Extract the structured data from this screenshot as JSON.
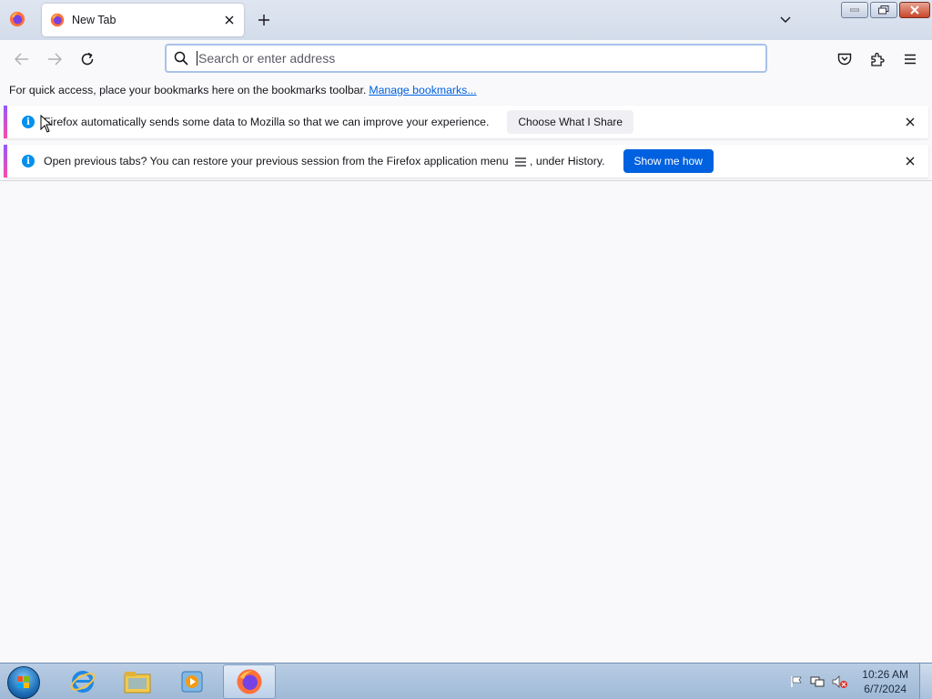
{
  "browser": {
    "tab": {
      "title": "New Tab"
    },
    "urlbar": {
      "placeholder": "Search or enter address",
      "value": ""
    }
  },
  "bookmarks_bar": {
    "text": "For quick access, place your bookmarks here on the bookmarks toolbar.",
    "link": "Manage bookmarks..."
  },
  "notifications": [
    {
      "message": "Firefox automatically sends some data to Mozilla so that we can improve your experience.",
      "button": "Choose What I Share"
    },
    {
      "message_before": "Open previous tabs? You can restore your previous session from the Firefox application menu",
      "message_after": ", under History.",
      "button": "Show me how"
    }
  ],
  "taskbar": {
    "clock_time": "10:26 AM",
    "clock_date": "6/7/2024"
  },
  "icons": [
    "firefox-icon",
    "close-icon",
    "plus-icon",
    "chevron-down-icon",
    "back-icon",
    "forward-icon",
    "reload-icon",
    "search-icon",
    "pocket-icon",
    "extensions-icon",
    "menu-icon",
    "info-icon"
  ],
  "colors": {
    "accent": "#0061e0",
    "info": "#0090ed",
    "notice_bar_top": "#9059ff",
    "notice_bar_bottom": "#ff4aa2"
  }
}
